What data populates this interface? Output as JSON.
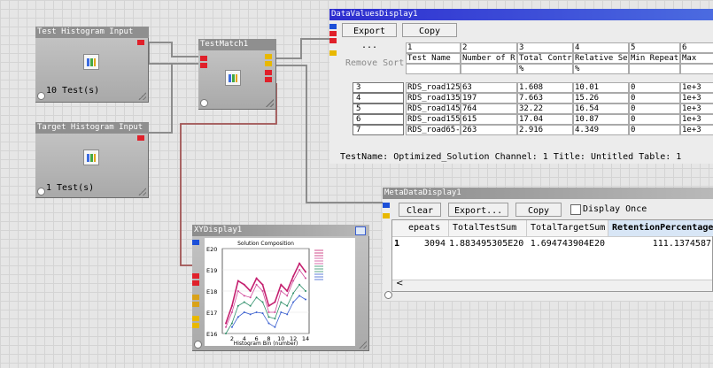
{
  "modules": {
    "test_hist": {
      "title": "Test Histogram Input",
      "count": "10 Test(s)"
    },
    "target_hist": {
      "title": "Target Histogram Input",
      "count": "1 Test(s)"
    },
    "test_match": {
      "title": "TestMatch1"
    }
  },
  "data_values": {
    "title": "DataValuesDisplay1",
    "export_label": "Export ...",
    "copy_label": "Copy",
    "remove_sort_label": "Remove Sort",
    "col_numbers": [
      "1",
      "2",
      "3",
      "4",
      "5",
      "6"
    ],
    "col_headers": [
      "Test Name",
      "Number of R",
      "Total Contr",
      "Relative Se",
      "Min Repeats",
      "Max"
    ],
    "units": [
      "",
      "",
      "%",
      "%",
      "",
      ""
    ],
    "rows": [
      {
        "num": "3",
        "cells": [
          "RDS_road125",
          "63",
          "1.608",
          "10.01",
          "0",
          "1e+3"
        ]
      },
      {
        "num": "4",
        "cells": [
          "RDS_road135",
          "197",
          "7.663",
          "15.26",
          "0",
          "1e+3"
        ]
      },
      {
        "num": "5",
        "cells": [
          "RDS_road145",
          "764",
          "32.22",
          "16.54",
          "0",
          "1e+3"
        ]
      },
      {
        "num": "6",
        "cells": [
          "RDS_road155",
          "615",
          "17.04",
          "10.87",
          "0",
          "1e+3"
        ]
      },
      {
        "num": "7",
        "cells": [
          "RDS_road65-",
          "263",
          "2.916",
          "4.349",
          "0",
          "1e+3"
        ]
      }
    ],
    "status": "TestName: Optimized_Solution  Channel: 1  Title: Untitled  Table: 1"
  },
  "meta": {
    "title": "MetaDataDisplay1",
    "clear_label": "Clear",
    "export_label": "Export...",
    "copy_label": "Copy",
    "display_once_label": "Display Once",
    "headers": [
      "epeats",
      "TotalTestSum",
      "TotalTargetSum",
      "RetentionPercentage"
    ],
    "row_num": "1",
    "values": [
      "3094",
      "1.883495305E20",
      "1.694743904E20",
      "111.1374587"
    ],
    "scroll_left": "<"
  },
  "xy": {
    "title": "XYDisplay1",
    "chart_data": {
      "type": "line",
      "title": "Solution Composition",
      "xlabel": "Histogram Bin (number)",
      "ylabel": "",
      "yscale": "log",
      "ylim": [
        1e+16,
        1e+20
      ],
      "y_ticks": [
        "E20",
        "E19",
        "E18",
        "E17",
        "E16"
      ],
      "x_ticks": [
        "2",
        "4",
        "6",
        "8",
        "10",
        "12",
        "14"
      ],
      "series": [
        {
          "color": "#c41e6e",
          "values": [
            3e+16,
            2e+17,
            3e+18,
            2e+18,
            1e+18,
            4e+18,
            2e+18,
            2e+17,
            3e+17,
            2e+18,
            1e+18,
            5e+18,
            2e+19,
            8e+18
          ]
        },
        {
          "color": "#d04a9a",
          "values": [
            2e+16,
            1e+17,
            1e+18,
            6e+17,
            5e+17,
            2e+18,
            1e+18,
            1e+17,
            1e+17,
            1e+18,
            6e+17,
            3e+18,
            1e+19,
            4e+18
          ]
        },
        {
          "color": "#2f8f6a",
          "values": [
            1e+16,
            3e+16,
            2e+17,
            3e+17,
            2e+17,
            5e+17,
            3e+17,
            6e+16,
            5e+16,
            3e+17,
            2e+17,
            8e+17,
            2e+18,
            1e+18
          ]
        },
        {
          "color": "#3a5fd0",
          "values": [
            null,
            2e+16,
            6e+16,
            1e+17,
            8e+16,
            1e+17,
            9e+16,
            3e+16,
            2e+16,
            1e+17,
            8e+16,
            3e+17,
            6e+17,
            4e+17
          ]
        }
      ]
    }
  }
}
